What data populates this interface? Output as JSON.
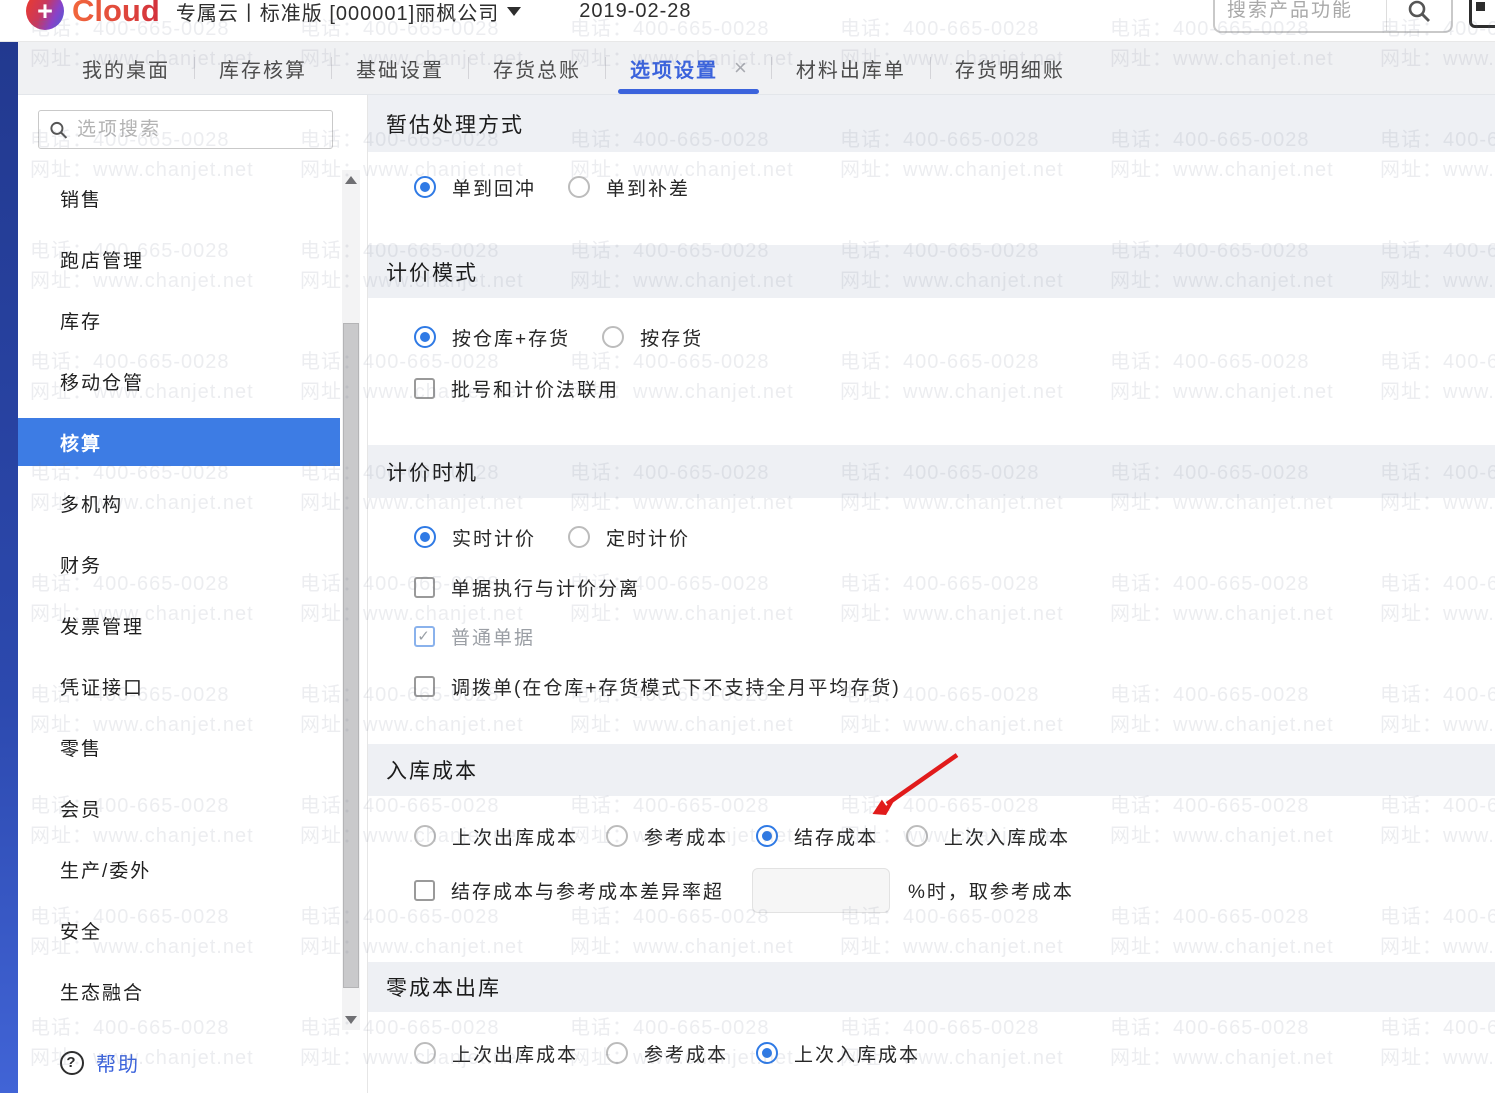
{
  "topbar": {
    "logo_text": "Cloud",
    "company": "专属云丨标准版 [000001]丽枫公司",
    "date": "2019-02-28",
    "search_placeholder": "搜索产品功能"
  },
  "tabs": {
    "items": [
      {
        "label": "我的桌面",
        "active": false
      },
      {
        "label": "库存核算",
        "active": false
      },
      {
        "label": "基础设置",
        "active": false
      },
      {
        "label": "存货总账",
        "active": false
      },
      {
        "label": "选项设置",
        "active": true,
        "close_glyph": "×"
      },
      {
        "label": "材料出库单",
        "active": false
      },
      {
        "label": "存货明细账",
        "active": false
      }
    ]
  },
  "sidebar": {
    "search_placeholder": "选项搜索",
    "items": [
      {
        "label": "销售",
        "selected": false
      },
      {
        "label": "跑店管理",
        "selected": false
      },
      {
        "label": "库存",
        "selected": false
      },
      {
        "label": "移动仓管",
        "selected": false
      },
      {
        "label": "核算",
        "selected": true
      },
      {
        "label": "多机构",
        "selected": false
      },
      {
        "label": "财务",
        "selected": false
      },
      {
        "label": "发票管理",
        "selected": false
      },
      {
        "label": "凭证接口",
        "selected": false
      },
      {
        "label": "零售",
        "selected": false
      },
      {
        "label": "会员",
        "selected": false
      },
      {
        "label": "生产/委外",
        "selected": false
      },
      {
        "label": "安全",
        "selected": false
      },
      {
        "label": "生态融合",
        "selected": false
      }
    ],
    "help_label": "帮助"
  },
  "main": {
    "sections": [
      {
        "title": "暂估处理方式",
        "options": [
          {
            "label": "单到回冲",
            "checked": true
          },
          {
            "label": "单到补差",
            "checked": false
          }
        ]
      },
      {
        "title": "计价模式",
        "options": [
          {
            "label": "按仓库+存货",
            "checked": true
          },
          {
            "label": "按存货",
            "checked": false
          }
        ],
        "checkbox": {
          "label": "批号和计价法联用",
          "checked": false
        }
      },
      {
        "title": "计价时机",
        "options": [
          {
            "label": "实时计价",
            "checked": true
          },
          {
            "label": "定时计价",
            "checked": false
          }
        ],
        "checkboxes": [
          {
            "label": "单据执行与计价分离",
            "checked": false,
            "disabled": false
          },
          {
            "label": "普通单据",
            "checked": true,
            "disabled": true
          },
          {
            "label": "调拨单(在仓库+存货模式下不支持全月平均存货)",
            "checked": false,
            "disabled": false
          }
        ]
      },
      {
        "title": "入库成本",
        "options": [
          {
            "label": "上次出库成本",
            "checked": false
          },
          {
            "label": "参考成本",
            "checked": false
          },
          {
            "label": "结存成本",
            "checked": true
          },
          {
            "label": "上次入库成本",
            "checked": false
          }
        ],
        "threshold": {
          "checkbox_label": "结存成本与参考成本差异率超",
          "checked": false,
          "input_value": "",
          "suffix_label": "%时，取参考成本"
        }
      },
      {
        "title": "零成本出库",
        "options": [
          {
            "label": "上次出库成本",
            "checked": false
          },
          {
            "label": "参考成本",
            "checked": false
          },
          {
            "label": "上次入库成本",
            "checked": true
          }
        ]
      }
    ]
  },
  "watermark": {
    "line1": "电话：400-665-0028",
    "line2": "网址：www.chanjet.net"
  },
  "colors": {
    "accent_blue": "#3b63dc",
    "selected_item_blue": "#3d7ce4",
    "radio_blue": "#2f7ae5",
    "section_band_bg": "#eef0f4",
    "navstrip_blue": "#2c49ae",
    "arrow_red": "#e11b1b"
  }
}
